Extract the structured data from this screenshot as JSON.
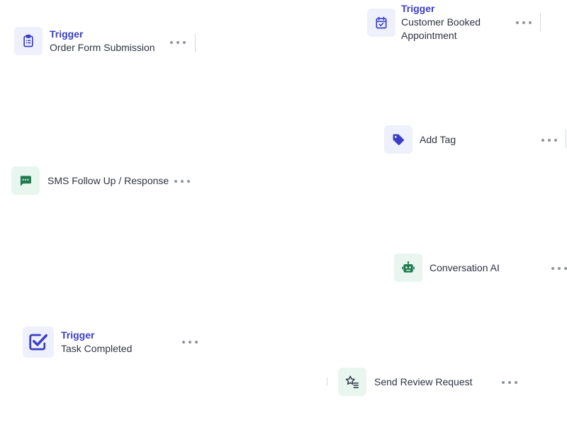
{
  "nodes": {
    "order_form": {
      "label": "Trigger",
      "title": "Order Form Submission",
      "icon": "clipboard-list-icon"
    },
    "customer_booked": {
      "label": "Trigger",
      "title_line1": "Customer Booked",
      "title_line2": "Appointment",
      "icon": "calendar-check-icon"
    },
    "add_tag": {
      "title": "Add Tag",
      "icon": "tag-icon"
    },
    "sms_follow_up": {
      "title": "SMS Follow Up / Response",
      "icon": "chat-bubble-icon"
    },
    "conversation_ai": {
      "title": "Conversation AI",
      "icon": "robot-icon"
    },
    "task_completed": {
      "label": "Trigger",
      "title": "Task Completed",
      "icon": "checkbox-checked-icon"
    },
    "send_review": {
      "title": "Send Review Request",
      "icon": "star-list-icon"
    }
  },
  "colors": {
    "trigger_accent": "#3b3ec4",
    "action_green": "#1f7a4f",
    "indigo_bg": "#eef0fb",
    "green_bg": "#e8f6ef",
    "menu_dots": "#8e929b"
  }
}
